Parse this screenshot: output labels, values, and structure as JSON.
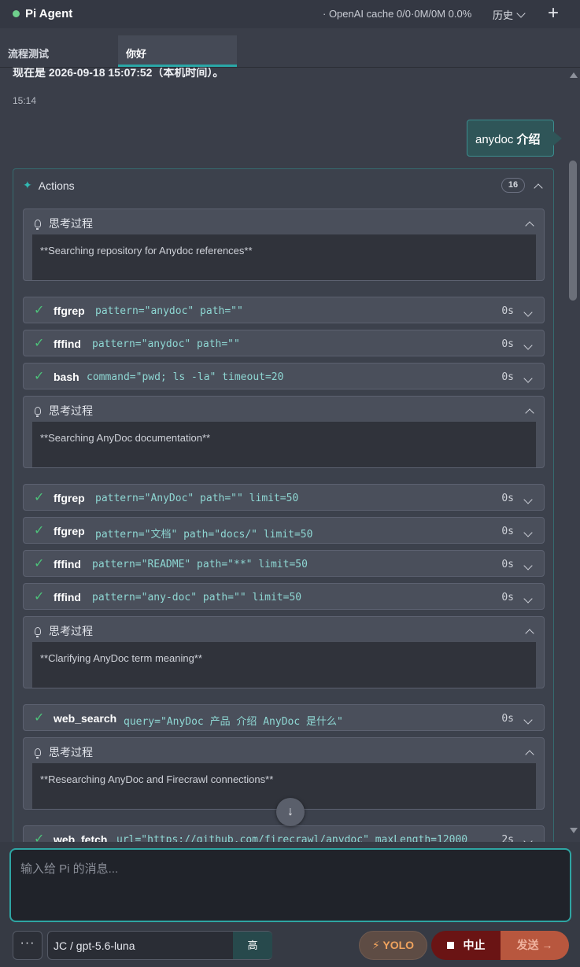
{
  "header": {
    "title": "Pi Agent",
    "cache_info": "· OpenAI cache 0/0·0M/0M 0.0%",
    "history_label": "历史",
    "new_label": "+"
  },
  "tabs": [
    {
      "label": "流程测试",
      "active": false
    },
    {
      "label": "你好",
      "active": true
    }
  ],
  "chat": {
    "prev_line": "现在是 2026-09-18 15:07:52（本机时间）。",
    "timestamp": "15:14",
    "user_message_prefix": "anydoc ",
    "user_message_bold": "介绍",
    "actions": {
      "title": "Actions",
      "count": "16",
      "thinking_label": "思考过程",
      "items": [
        {
          "kind": "think",
          "text": "**Searching repository for Anydoc references**"
        },
        {
          "kind": "tool",
          "name": "ffgrep",
          "args": "pattern=\"anydoc\" path=\"\"",
          "time": "0s"
        },
        {
          "kind": "tool",
          "name": "fffind",
          "args": "pattern=\"anydoc\" path=\"\"",
          "time": "0s"
        },
        {
          "kind": "tool",
          "name": "bash",
          "args": "command=\"pwd; ls -la\" timeout=20",
          "time": "0s"
        },
        {
          "kind": "think",
          "text": "**Searching AnyDoc documentation**"
        },
        {
          "kind": "tool",
          "name": "ffgrep",
          "args": "pattern=\"AnyDoc\" path=\"\" limit=50",
          "time": "0s"
        },
        {
          "kind": "tool",
          "name": "ffgrep",
          "args": "pattern=\"文档\" path=\"docs/\" limit=50",
          "time": "0s"
        },
        {
          "kind": "tool",
          "name": "fffind",
          "args": "pattern=\"README\" path=\"**\" limit=50",
          "time": "0s"
        },
        {
          "kind": "tool",
          "name": "fffind",
          "args": "pattern=\"any-doc\" path=\"\" limit=50",
          "time": "0s"
        },
        {
          "kind": "think",
          "text": "**Clarifying AnyDoc term meaning**"
        },
        {
          "kind": "tool",
          "name": "web_search",
          "args": "query=\"AnyDoc 产品 介绍 AnyDoc 是什么\"",
          "time": "0s"
        },
        {
          "kind": "think",
          "text": "**Researching AnyDoc and Firecrawl connections**"
        },
        {
          "kind": "tool",
          "name": "web_fetch",
          "args": "url=\"https://github.com/firecrawl/anydoc\" maxLength=12000",
          "time": "2s"
        }
      ]
    }
  },
  "composer": {
    "placeholder": "输入给 Pi 的消息...",
    "more_label": "···",
    "model": "JC / gpt-5.6-luna",
    "effort": "高",
    "yolo_label": "YOLO",
    "yolo_icon": "⚡",
    "stop_label": "中止",
    "send_label": "发送 →"
  },
  "colors": {
    "accent": "#2ea5a3",
    "status_green": "#6fd08c",
    "stop": "#6a1414",
    "send": "#b8573e",
    "yolo": "#f0a35e"
  }
}
